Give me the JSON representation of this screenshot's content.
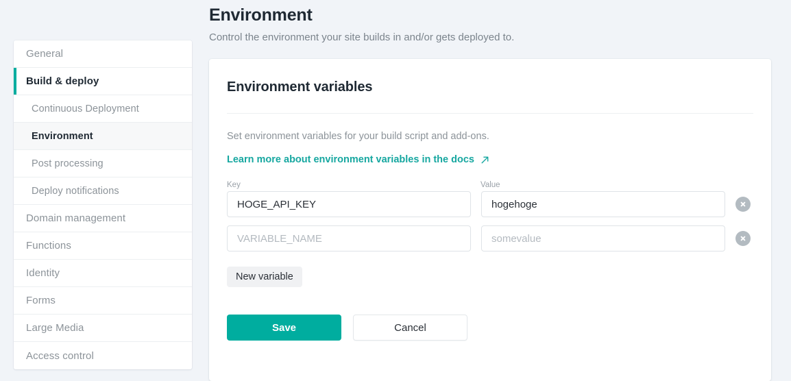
{
  "header": {
    "title": "Environment",
    "subtitle": "Control the environment your site builds in and/or gets deployed to."
  },
  "sidebar": {
    "items": [
      {
        "label": "General",
        "level": "top",
        "state": "normal"
      },
      {
        "label": "Build & deploy",
        "level": "top",
        "state": "active"
      },
      {
        "label": "Continuous Deployment",
        "level": "sub",
        "state": "normal"
      },
      {
        "label": "Environment",
        "level": "sub",
        "state": "selected"
      },
      {
        "label": "Post processing",
        "level": "sub",
        "state": "normal"
      },
      {
        "label": "Deploy notifications",
        "level": "sub",
        "state": "normal"
      },
      {
        "label": "Domain management",
        "level": "top",
        "state": "normal"
      },
      {
        "label": "Functions",
        "level": "top",
        "state": "normal"
      },
      {
        "label": "Identity",
        "level": "top",
        "state": "normal"
      },
      {
        "label": "Forms",
        "level": "top",
        "state": "normal"
      },
      {
        "label": "Large Media",
        "level": "top",
        "state": "normal"
      },
      {
        "label": "Access control",
        "level": "top",
        "state": "normal"
      }
    ]
  },
  "card": {
    "title": "Environment variables",
    "description": "Set environment variables for your build script and add-ons.",
    "docs_link": "Learn more about environment variables in the docs",
    "docs_link_icon": "external-link-icon"
  },
  "form": {
    "key_label": "Key",
    "value_label": "Value",
    "rows": [
      {
        "key_value": "HOGE_API_KEY",
        "key_placeholder": "VARIABLE_NAME",
        "value_value": "hogehoge",
        "value_placeholder": "somevalue",
        "remove_icon": "close-circle-icon"
      },
      {
        "key_value": "",
        "key_placeholder": "VARIABLE_NAME",
        "value_value": "",
        "value_placeholder": "somevalue",
        "remove_icon": "close-circle-icon"
      }
    ],
    "new_variable_label": "New variable",
    "save_label": "Save",
    "cancel_label": "Cancel"
  },
  "colors": {
    "accent_teal": "#00ad9f",
    "link_teal": "#16a7a0",
    "page_background": "#f1f4f8",
    "card_background": "#ffffff",
    "muted_text": "#8c9399",
    "remove_button": "#b3bbc1"
  }
}
